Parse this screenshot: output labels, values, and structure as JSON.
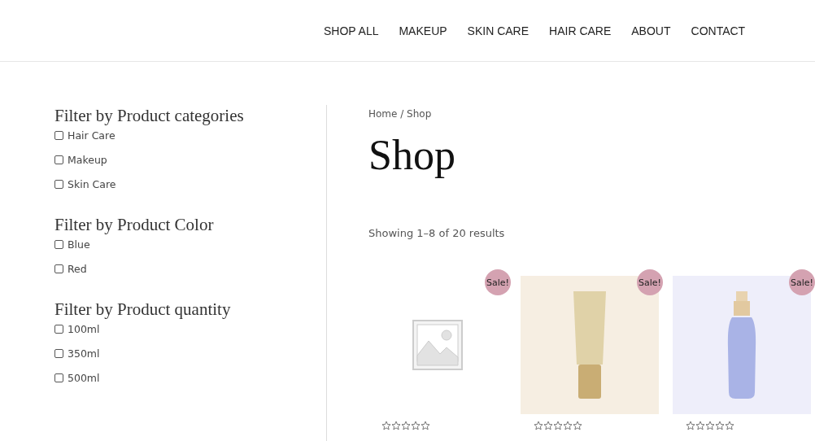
{
  "nav": {
    "items": [
      "SHOP ALL",
      "MAKEUP",
      "SKIN CARE",
      "HAIR CARE",
      "ABOUT",
      "CONTACT"
    ]
  },
  "filters": [
    {
      "title": "Filter by Product categories",
      "options": [
        {
          "label": "Hair Care",
          "checked": false
        },
        {
          "label": "Makeup",
          "checked": false
        },
        {
          "label": "Skin Care",
          "checked": false
        }
      ]
    },
    {
      "title": "Filter by Product Color",
      "options": [
        {
          "label": "Blue",
          "checked": false
        },
        {
          "label": "Red",
          "checked": false
        }
      ]
    },
    {
      "title": "Filter by Product quantity",
      "options": [
        {
          "label": "100ml",
          "checked": false
        },
        {
          "label": "350ml",
          "checked": false
        },
        {
          "label": "500ml",
          "checked": false
        }
      ]
    }
  ],
  "breadcrumb": "Home / Shop",
  "title": "Shop",
  "result_count": "Showing 1–8 of 20 results",
  "products": [
    {
      "kind": "placeholder",
      "badge": "Sale!",
      "stars": 0
    },
    {
      "kind": "tube",
      "badge": "Sale!",
      "stars": 0
    },
    {
      "kind": "bottle",
      "badge": "Sale!",
      "stars": 0
    }
  ]
}
